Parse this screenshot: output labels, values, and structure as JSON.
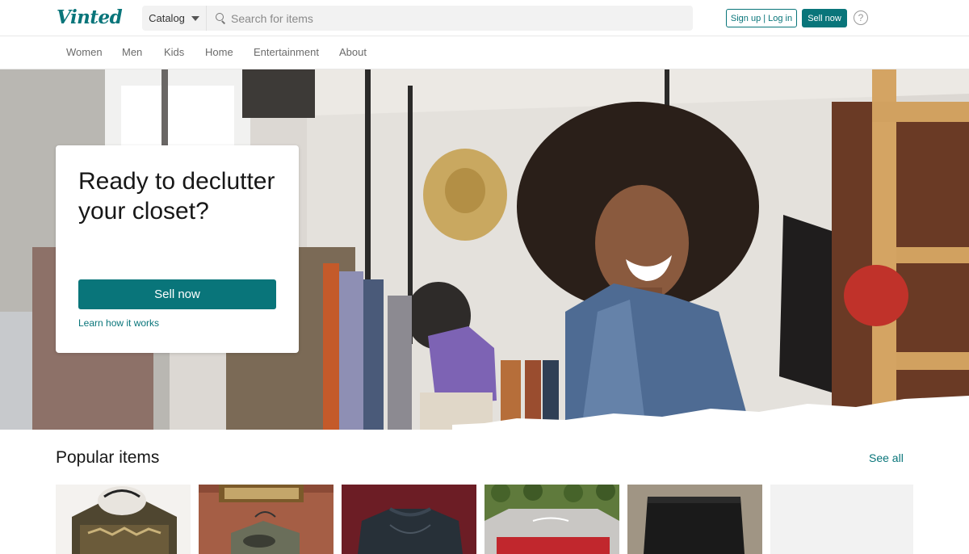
{
  "header": {
    "logo": "Vinted",
    "catalog_label": "Catalog",
    "search_placeholder": "Search for items",
    "signup_label": "Sign up | Log in",
    "sell_label": "Sell now",
    "help_icon": "question-circle-icon"
  },
  "nav": {
    "items": [
      "Women",
      "Men",
      "Kids",
      "Home",
      "Entertainment",
      "About"
    ]
  },
  "hero": {
    "title": "Ready to declutter your closet?",
    "sell_label": "Sell now",
    "learn_label": "Learn how it works"
  },
  "popular": {
    "title": "Popular items",
    "see_all": "See all"
  },
  "colors": {
    "brand": "#09757a"
  }
}
